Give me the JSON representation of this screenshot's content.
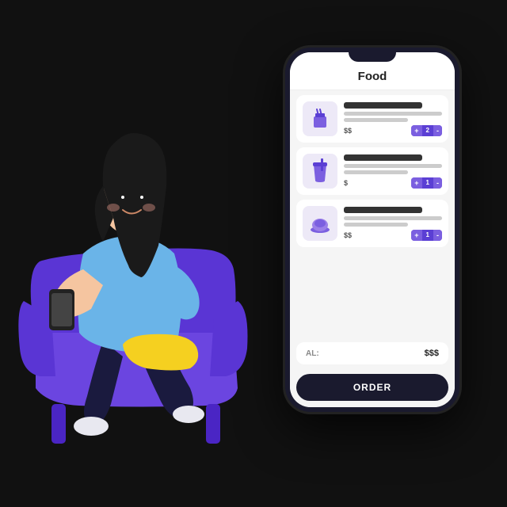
{
  "scene": {
    "background_color": "#111111"
  },
  "phone": {
    "screen_title": "Food",
    "items": [
      {
        "id": "item-1",
        "icon": "noodles",
        "price": "$$",
        "quantity": 2,
        "qty_label": "+ 2 -"
      },
      {
        "id": "item-2",
        "icon": "drink",
        "price": "$",
        "quantity": 1,
        "qty_label": "+ 1 -"
      },
      {
        "id": "item-3",
        "icon": "food3",
        "price": "$$",
        "quantity": 1,
        "qty_label": "+ 1 -"
      }
    ],
    "total_label": "AL:",
    "total_value": "$$$",
    "order_button_label": "ORDER"
  }
}
